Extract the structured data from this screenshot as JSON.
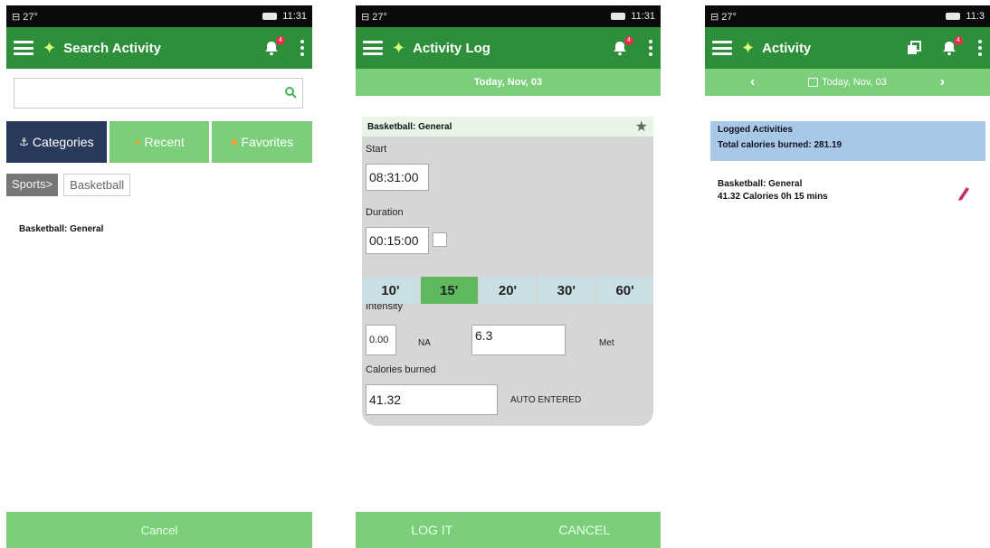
{
  "status": {
    "left": "⊟  27°",
    "time_1": "11:31",
    "time_2": "11:31",
    "time_3": "11:3"
  },
  "screen1": {
    "title": "Search Activity",
    "notifications": "4",
    "search": {
      "placeholder": "",
      "value": ""
    },
    "tabs": {
      "categories": "Categories",
      "recent": "Recent",
      "favorites": "Favorites"
    },
    "breadcrumbs": {
      "sports": "Sports>",
      "basketball": "Basketball"
    },
    "result": "Basketball: General",
    "cancel": "Cancel"
  },
  "screen2": {
    "title": "Activity Log",
    "notifications": "4",
    "date": "Today, Nov, 03",
    "activity": "Basketball: General",
    "start_label": "Start",
    "start_value": "08:31:00",
    "duration_label": "Duration",
    "duration_value": "00:15:00",
    "durations": [
      "10'",
      "15'",
      "20'",
      "30'",
      "60'"
    ],
    "selected_duration": "15'",
    "intensity_label": "Intensity",
    "intensity_value": "0.00",
    "intensity_na": "NA",
    "met_value": "6.3",
    "met_unit": "Met",
    "calories_label": "Calories burned",
    "calories_value": "41.32",
    "auto_entered": "AUTO ENTERED",
    "log_it": "LOG IT",
    "cancel": "CANCEL"
  },
  "screen3": {
    "title": "Activity",
    "notifications": "4",
    "date": "Today, Nov, 03",
    "logged_title": "Logged Activities",
    "total_calories": "Total calories burned: 281.19",
    "entry_name": "Basketball: General",
    "entry_detail": "41.32 Calories 0h 15 mins"
  },
  "colors": {
    "appbar": "#2e8f3a",
    "light_green": "#7ccf7a",
    "categories_tab": "#2a3a5c",
    "logged_panel": "#a8c8e8",
    "pencil": "#c0306a"
  }
}
